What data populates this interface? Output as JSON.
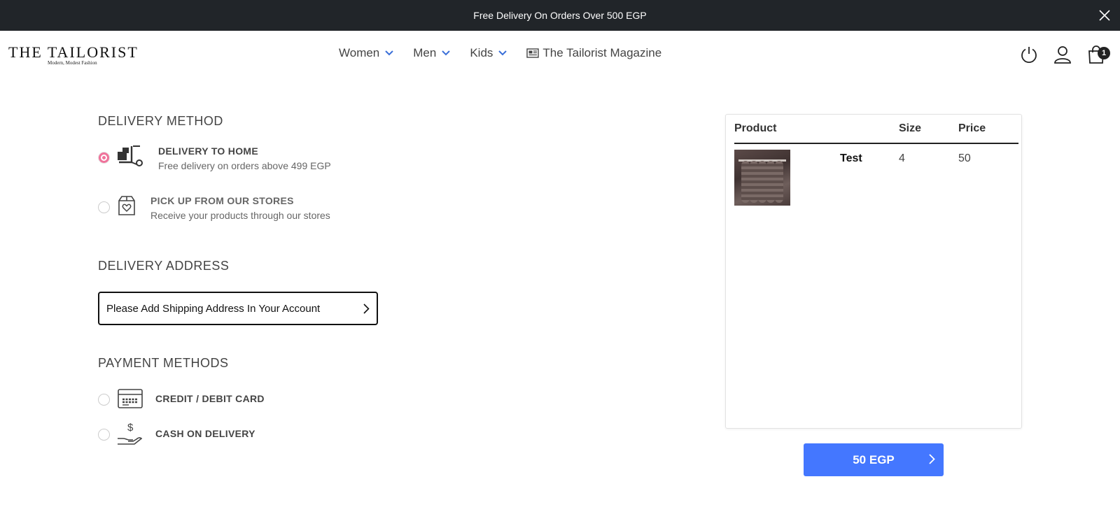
{
  "announcement": {
    "text": "Free Delivery On Orders Over 500 EGP"
  },
  "header": {
    "brand": "The Tailorist",
    "tagline": "Modern, Modest Fashion",
    "nav": [
      {
        "label": "Women"
      },
      {
        "label": "Men"
      },
      {
        "label": "Kids"
      }
    ],
    "magazine": "The Tailorist Magazine",
    "cart_count": "1"
  },
  "delivery": {
    "title": "DELIVERY METHOD",
    "options": [
      {
        "title": "DELIVERY TO HOME",
        "subtitle": "Free delivery on orders above 499 EGP",
        "selected": true,
        "icon": "delivery-cart-icon"
      },
      {
        "title": "PICK UP FROM OUR STORES",
        "subtitle": "Receive your products through our stores",
        "selected": false,
        "icon": "store-box-icon"
      }
    ]
  },
  "address": {
    "title": "DELIVERY ADDRESS",
    "prompt": "Please Add Shipping Address In Your Account"
  },
  "payment": {
    "title": "PAYMENT METHODS",
    "options": [
      {
        "title": "CREDIT / DEBIT CARD",
        "icon": "credit-card-icon",
        "selected": false
      },
      {
        "title": "CASH ON DELIVERY",
        "icon": "cash-hand-icon",
        "selected": false
      }
    ]
  },
  "summary": {
    "headers": {
      "product": "Product",
      "size": "Size",
      "price": "Price"
    },
    "items": [
      {
        "name": "Test",
        "size": "4",
        "price": "50"
      }
    ]
  },
  "total": {
    "label": "50 EGP"
  },
  "colors": {
    "accent": "#4477ff",
    "radio_selected": "#f0739b",
    "topbar": "#212529"
  }
}
